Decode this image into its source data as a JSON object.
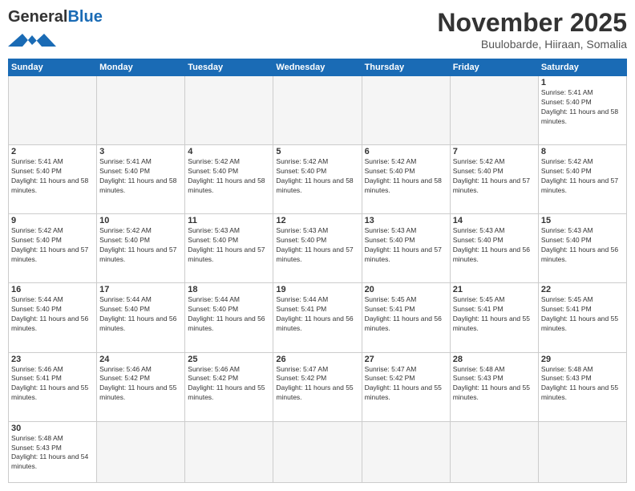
{
  "header": {
    "logo_general": "General",
    "logo_blue": "Blue",
    "month_title": "November 2025",
    "subtitle": "Buulobarde, Hiiraan, Somalia"
  },
  "weekdays": [
    "Sunday",
    "Monday",
    "Tuesday",
    "Wednesday",
    "Thursday",
    "Friday",
    "Saturday"
  ],
  "days": {
    "1": {
      "sunrise": "5:41 AM",
      "sunset": "5:40 PM",
      "daylight": "11 hours and 58 minutes."
    },
    "2": {
      "sunrise": "5:41 AM",
      "sunset": "5:40 PM",
      "daylight": "11 hours and 58 minutes."
    },
    "3": {
      "sunrise": "5:41 AM",
      "sunset": "5:40 PM",
      "daylight": "11 hours and 58 minutes."
    },
    "4": {
      "sunrise": "5:42 AM",
      "sunset": "5:40 PM",
      "daylight": "11 hours and 58 minutes."
    },
    "5": {
      "sunrise": "5:42 AM",
      "sunset": "5:40 PM",
      "daylight": "11 hours and 58 minutes."
    },
    "6": {
      "sunrise": "5:42 AM",
      "sunset": "5:40 PM",
      "daylight": "11 hours and 58 minutes."
    },
    "7": {
      "sunrise": "5:42 AM",
      "sunset": "5:40 PM",
      "daylight": "11 hours and 57 minutes."
    },
    "8": {
      "sunrise": "5:42 AM",
      "sunset": "5:40 PM",
      "daylight": "11 hours and 57 minutes."
    },
    "9": {
      "sunrise": "5:42 AM",
      "sunset": "5:40 PM",
      "daylight": "11 hours and 57 minutes."
    },
    "10": {
      "sunrise": "5:42 AM",
      "sunset": "5:40 PM",
      "daylight": "11 hours and 57 minutes."
    },
    "11": {
      "sunrise": "5:43 AM",
      "sunset": "5:40 PM",
      "daylight": "11 hours and 57 minutes."
    },
    "12": {
      "sunrise": "5:43 AM",
      "sunset": "5:40 PM",
      "daylight": "11 hours and 57 minutes."
    },
    "13": {
      "sunrise": "5:43 AM",
      "sunset": "5:40 PM",
      "daylight": "11 hours and 57 minutes."
    },
    "14": {
      "sunrise": "5:43 AM",
      "sunset": "5:40 PM",
      "daylight": "11 hours and 56 minutes."
    },
    "15": {
      "sunrise": "5:43 AM",
      "sunset": "5:40 PM",
      "daylight": "11 hours and 56 minutes."
    },
    "16": {
      "sunrise": "5:44 AM",
      "sunset": "5:40 PM",
      "daylight": "11 hours and 56 minutes."
    },
    "17": {
      "sunrise": "5:44 AM",
      "sunset": "5:40 PM",
      "daylight": "11 hours and 56 minutes."
    },
    "18": {
      "sunrise": "5:44 AM",
      "sunset": "5:40 PM",
      "daylight": "11 hours and 56 minutes."
    },
    "19": {
      "sunrise": "5:44 AM",
      "sunset": "5:41 PM",
      "daylight": "11 hours and 56 minutes."
    },
    "20": {
      "sunrise": "5:45 AM",
      "sunset": "5:41 PM",
      "daylight": "11 hours and 56 minutes."
    },
    "21": {
      "sunrise": "5:45 AM",
      "sunset": "5:41 PM",
      "daylight": "11 hours and 55 minutes."
    },
    "22": {
      "sunrise": "5:45 AM",
      "sunset": "5:41 PM",
      "daylight": "11 hours and 55 minutes."
    },
    "23": {
      "sunrise": "5:46 AM",
      "sunset": "5:41 PM",
      "daylight": "11 hours and 55 minutes."
    },
    "24": {
      "sunrise": "5:46 AM",
      "sunset": "5:42 PM",
      "daylight": "11 hours and 55 minutes."
    },
    "25": {
      "sunrise": "5:46 AM",
      "sunset": "5:42 PM",
      "daylight": "11 hours and 55 minutes."
    },
    "26": {
      "sunrise": "5:47 AM",
      "sunset": "5:42 PM",
      "daylight": "11 hours and 55 minutes."
    },
    "27": {
      "sunrise": "5:47 AM",
      "sunset": "5:42 PM",
      "daylight": "11 hours and 55 minutes."
    },
    "28": {
      "sunrise": "5:48 AM",
      "sunset": "5:43 PM",
      "daylight": "11 hours and 55 minutes."
    },
    "29": {
      "sunrise": "5:48 AM",
      "sunset": "5:43 PM",
      "daylight": "11 hours and 55 minutes."
    },
    "30": {
      "sunrise": "5:48 AM",
      "sunset": "5:43 PM",
      "daylight": "11 hours and 54 minutes."
    }
  }
}
